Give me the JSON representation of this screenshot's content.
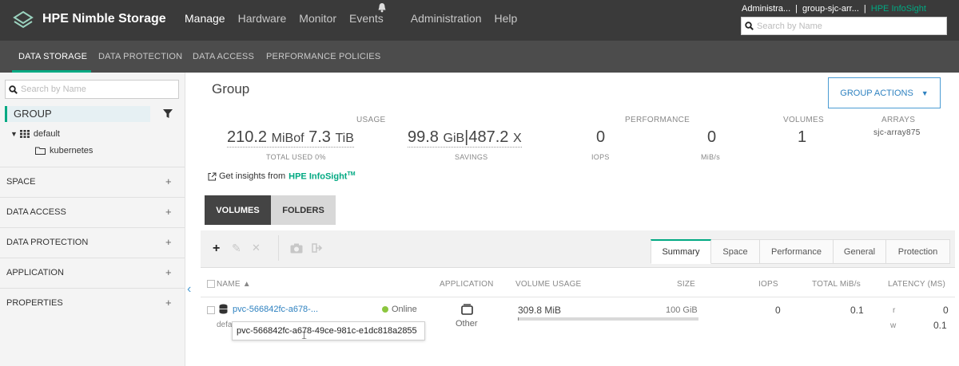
{
  "brand": {
    "name": "HPE Nimble Storage",
    "accent": "#01a982",
    "link_color": "#2f82c0"
  },
  "main_nav": [
    "Manage",
    "Hardware",
    "Monitor",
    "Events",
    "Administration",
    "Help"
  ],
  "main_nav_active": "Manage",
  "user_bar": {
    "user": "Administra...",
    "group": "group-sjc-arr...",
    "infosight": "HPE InfoSight",
    "sep": "|"
  },
  "top_search": {
    "placeholder": "Search by Name"
  },
  "sub_nav": [
    "DATA STORAGE",
    "DATA PROTECTION",
    "DATA ACCESS",
    "PERFORMANCE POLICIES"
  ],
  "sub_nav_active": "DATA STORAGE",
  "sidebar": {
    "search_placeholder": "Search by Name",
    "group_label": "GROUP",
    "tree": {
      "folder": "default",
      "child": "kubernetes"
    },
    "sections": [
      "SPACE",
      "DATA ACCESS",
      "DATA PROTECTION",
      "APPLICATION",
      "PROPERTIES"
    ],
    "plus": "+"
  },
  "page": {
    "title": "Group",
    "actions_button": "GROUP ACTIONS"
  },
  "stats": {
    "usage_head": "USAGE",
    "used_value": "210.2",
    "used_unit": "MiB",
    "of": "of",
    "total_value": "7.3",
    "total_unit": "TiB",
    "total_used_label": "TOTAL USED 0%",
    "savings_value": "99.8",
    "savings_unit": "GiB",
    "ratio_value": "487.2",
    "ratio_unit": "X",
    "savings_label": "SAVINGS",
    "performance_head": "PERFORMANCE",
    "iops_value": "0",
    "iops_label": "IOPS",
    "mibs_value": "0",
    "mibs_label": "MiB/s",
    "volumes_head": "VOLUMES",
    "volumes_value": "1",
    "arrays_head": "ARRAYS",
    "arrays_value": "sjc-array875"
  },
  "insight": {
    "text": "Get insights from",
    "link": "HPE InfoSight",
    "tm": "TM"
  },
  "view_toggle": {
    "volumes": "VOLUMES",
    "folders": "FOLDERS"
  },
  "toolbar": {
    "add": "+",
    "edit": "✎",
    "delete": "✕",
    "snapshot": "📷",
    "move": "➦"
  },
  "detail_tabs": [
    "Summary",
    "Space",
    "Performance",
    "General",
    "Protection"
  ],
  "detail_tab_active": "Summary",
  "table": {
    "headers": {
      "name": "NAME",
      "application": "APPLICATION",
      "volume_usage": "VOLUME USAGE",
      "size": "SIZE",
      "iops": "IOPS",
      "total_mibs": "TOTAL MiB/s",
      "latency": "LATENCY (MS)"
    },
    "rows": [
      {
        "name": "pvc-566842fc-a678-...",
        "folder": "defa",
        "status": "Online",
        "application": "Other",
        "usage": "309.8 MiB",
        "usage_fraction": 0.003,
        "size": "100 GiB",
        "iops": "0",
        "total_mibs": "0.1",
        "latency_r_label": "r",
        "latency_r": "0",
        "latency_w_label": "w",
        "latency_w": "0.1"
      }
    ],
    "tooltip": "pvc-566842fc-a678-49ce-981c-e1dc818a2855"
  }
}
